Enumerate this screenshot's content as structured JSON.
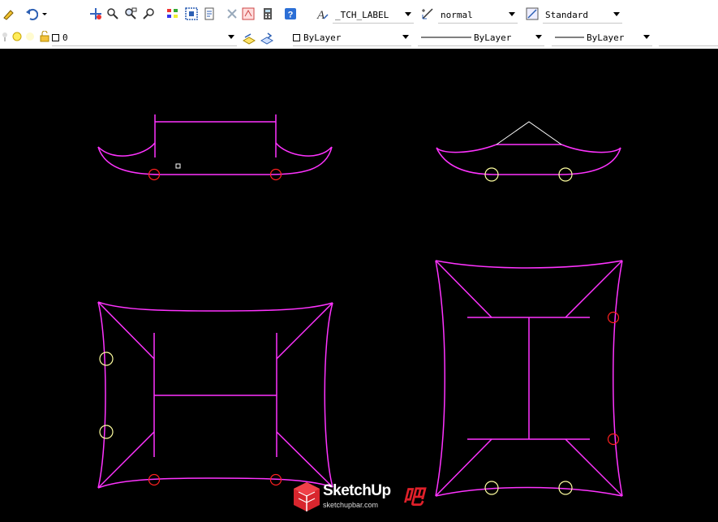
{
  "toolbar": {
    "text_style": {
      "value": "_TCH_LABEL"
    },
    "dim_style": {
      "value": "normal"
    },
    "table_style": {
      "value": "Standard"
    },
    "layer": {
      "value": "0"
    },
    "color": {
      "value": "ByLayer"
    },
    "linetype": {
      "value": "ByLayer"
    },
    "lineweight": {
      "value": "ByLayer"
    }
  },
  "watermark": {
    "brand": "SketchUp",
    "bar": "吧",
    "url": "sketchupbar.com"
  },
  "colors": {
    "magenta": "#ff33ff",
    "red": "#ff2020",
    "yellow": "#ffffa0",
    "white": "#ffffff"
  }
}
